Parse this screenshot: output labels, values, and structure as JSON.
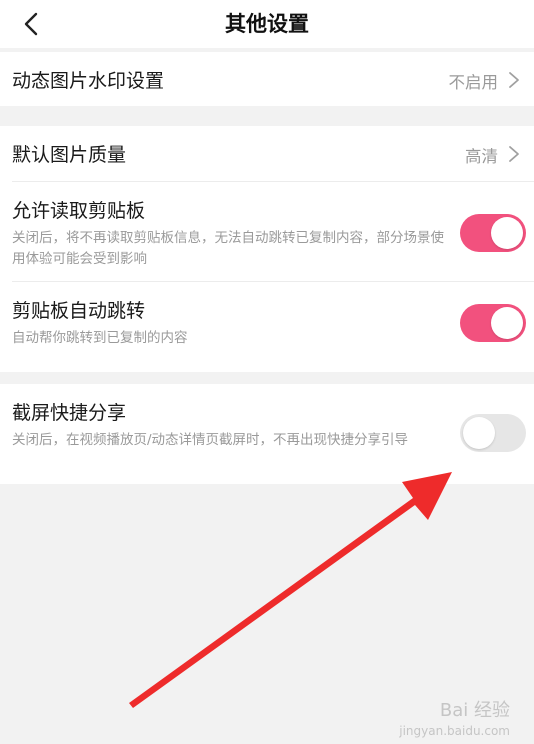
{
  "header": {
    "title": "其他设置",
    "back_icon": "chevron-left-icon"
  },
  "settings": {
    "watermark": {
      "label": "动态图片水印设置",
      "value": "不启用"
    },
    "image_quality": {
      "label": "默认图片质量",
      "value": "高清"
    },
    "clipboard_read": {
      "label": "允许读取剪贴板",
      "description": "关闭后，将不再读取剪贴板信息，无法自动跳转已复制内容，部分场景使用体验可能会受到影响",
      "enabled": true
    },
    "clipboard_jump": {
      "label": "剪贴板自动跳转",
      "description": "自动帮你跳转到已复制的内容",
      "enabled": true
    },
    "screenshot_share": {
      "label": "截屏快捷分享",
      "description": "关闭后，在视频播放页/动态详情页截屏时，不再出现快捷分享引导",
      "enabled": false
    }
  },
  "colors": {
    "toggle_on": "#f2517e",
    "toggle_off": "#e6e6e6",
    "annotation_arrow": "#ee2b2b",
    "background": "#f2f2f2"
  },
  "watermark": {
    "brand": "Bai 经验",
    "site": "jingyan.baidu.com"
  }
}
